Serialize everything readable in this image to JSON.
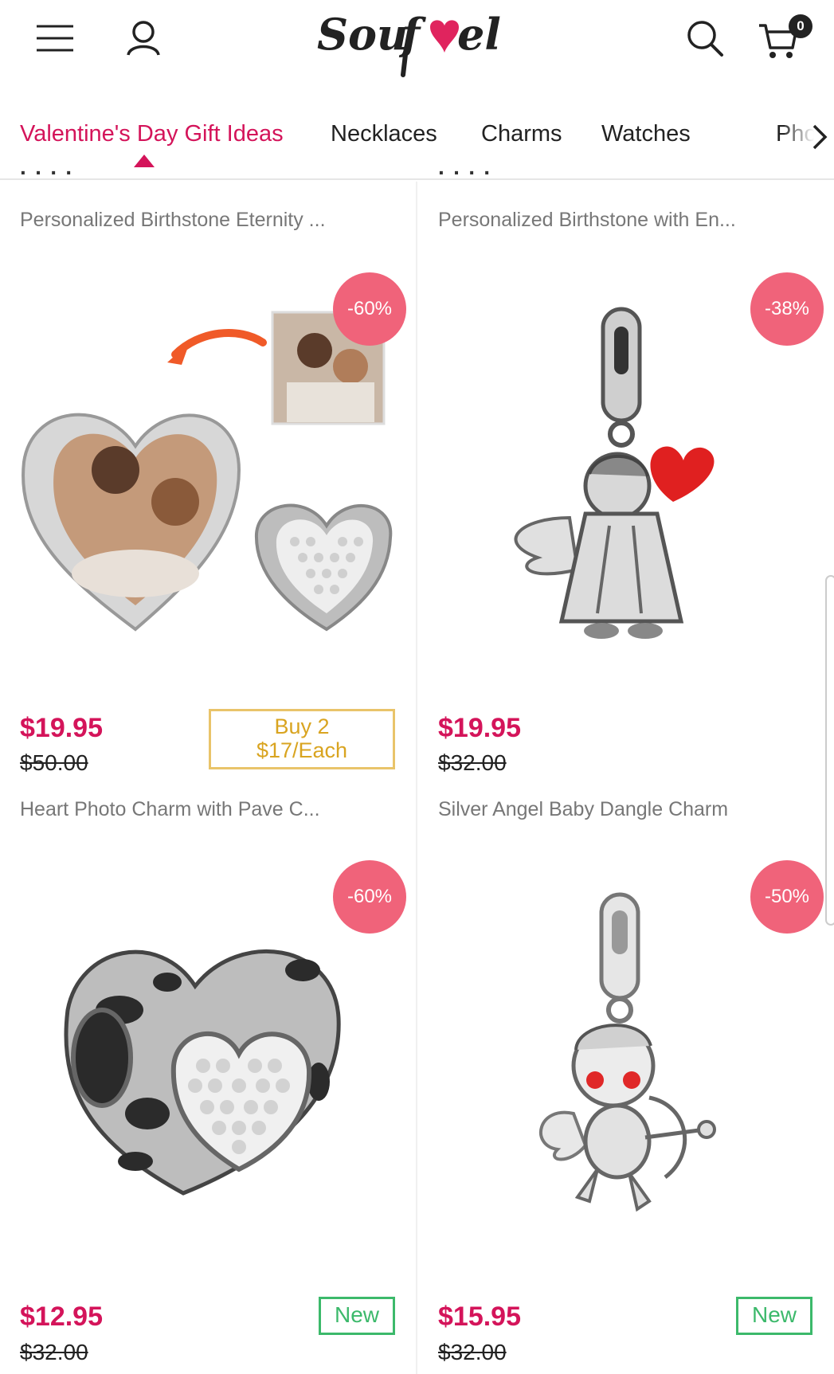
{
  "header": {
    "brand": "Soufeel",
    "cart_count": "0",
    "icons": [
      "hamburger-menu-icon",
      "user-icon",
      "search-icon",
      "cart-icon"
    ]
  },
  "category_nav": {
    "items": [
      "Valentine's Day Gift Ideas",
      "Necklaces",
      "Charms",
      "Watches",
      "Pho"
    ],
    "active_index": 0
  },
  "prev_row": {
    "left_name": "Personalized Birthstone Eternity ...",
    "right_name": "Personalized Birthstone with En..."
  },
  "products": [
    {
      "discount": "-60%",
      "price": "$19.95",
      "old_price": "$50.00",
      "promo_line1": "Buy 2",
      "promo_line2": "$17/Each",
      "name": "Heart Photo Charm with Pave C..."
    },
    {
      "discount": "-38%",
      "price": "$19.95",
      "old_price": "$32.00",
      "name": "Silver Angel Baby Dangle Charm"
    },
    {
      "discount": "-60%",
      "price": "$12.95",
      "old_price": "$32.00",
      "badge": "New"
    },
    {
      "discount": "-50%",
      "price": "$15.95",
      "old_price": "$32.00",
      "badge": "New"
    }
  ],
  "colors": {
    "accent": "#d4145a",
    "discount_bg": "#f0637a",
    "promo_border": "#e9c46a",
    "new_badge": "#3cb96b"
  }
}
